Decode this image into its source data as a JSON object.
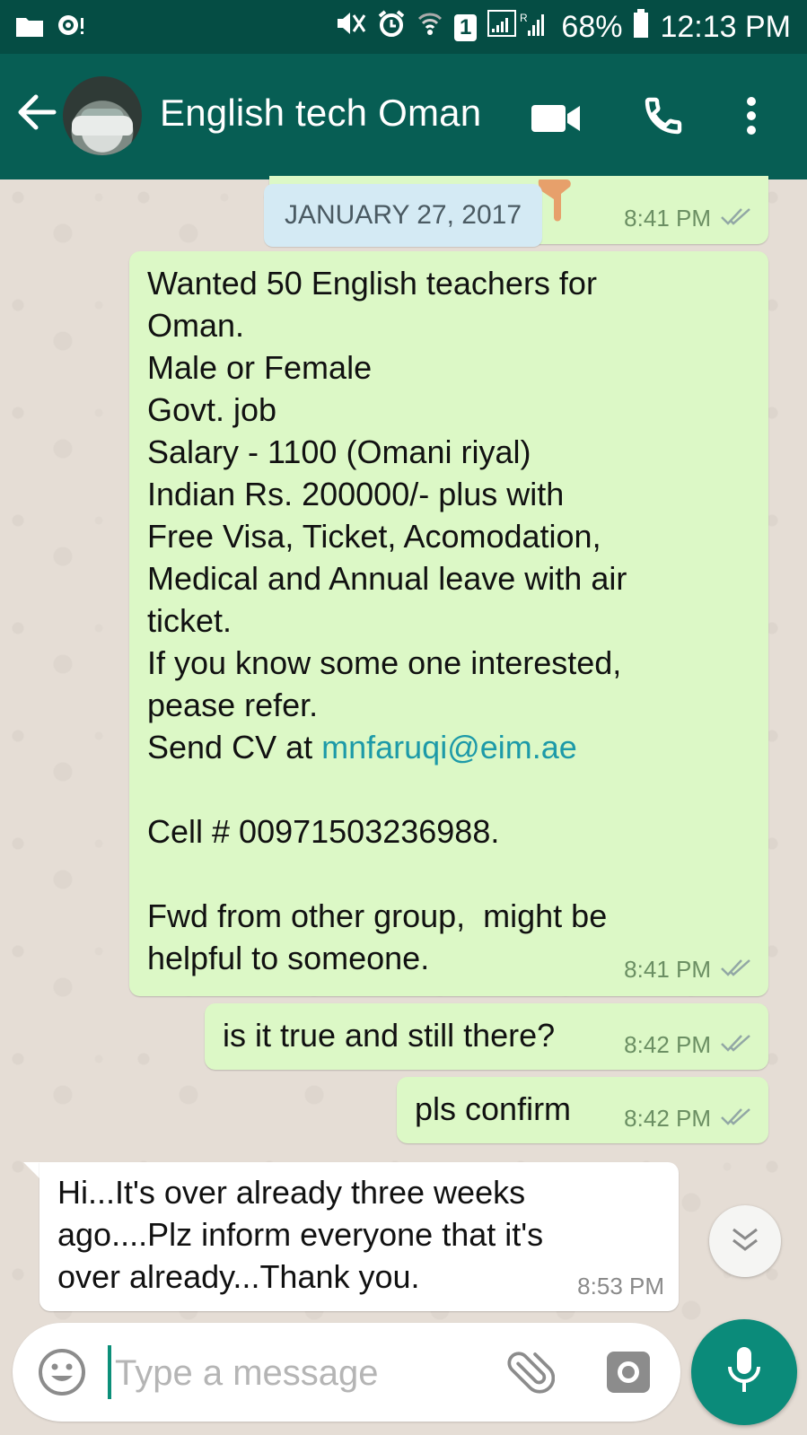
{
  "status_bar": {
    "battery": "68%",
    "time": "12:13 PM",
    "sim_badge": "1"
  },
  "app_bar": {
    "contact_name": "English tech Oman",
    "icons": [
      "back-arrow-icon",
      "video-call-icon",
      "phone-icon",
      "more-options-icon"
    ]
  },
  "chat": {
    "date_label": "JANUARY 27, 2017",
    "first_partial_time": "8:41 PM",
    "messages": [
      {
        "direction": "outgoing",
        "lines": [
          "Wanted 50 English teachers for",
          "Oman.",
          "Male or Female",
          "Govt. job",
          "Salary - 1100 (Omani riyal)",
          "Indian Rs. 200000/- plus with",
          "Free Visa, Ticket, Acomodation,",
          "Medical and Annual leave with air",
          "ticket.",
          "If you know some one interested,",
          "pease refer."
        ],
        "cv_prefix": "Send CV at ",
        "email": "mnfaruqi@eim.ae",
        "cell": "Cell # 00971503236988.",
        "footer_lines": [
          "Fwd from other group,  might be",
          "helpful to someone."
        ],
        "time": "8:41 PM",
        "status": "read"
      },
      {
        "direction": "outgoing",
        "text": "is it true and still there?",
        "time": "8:42 PM",
        "status": "read"
      },
      {
        "direction": "outgoing",
        "text": "pls confirm",
        "time": "8:42 PM",
        "status": "read"
      },
      {
        "direction": "incoming",
        "lines": [
          "Hi...It's over already three weeks",
          "ago....Plz inform everyone that it's",
          "over already...Thank you."
        ],
        "time": "8:53 PM"
      }
    ]
  },
  "composer": {
    "placeholder": "Type a message",
    "icons": [
      "emoji-icon",
      "paperclip-icon",
      "camera-icon",
      "microphone-icon"
    ]
  },
  "colors": {
    "app_bar": "#075e54",
    "status_bar": "#054d44",
    "outgoing_bubble": "#dcf8c6",
    "incoming_bubble": "#ffffff",
    "chat_bg": "#e5ddd5",
    "link": "#1d9aa8",
    "mic_button": "#0b8b7a"
  }
}
